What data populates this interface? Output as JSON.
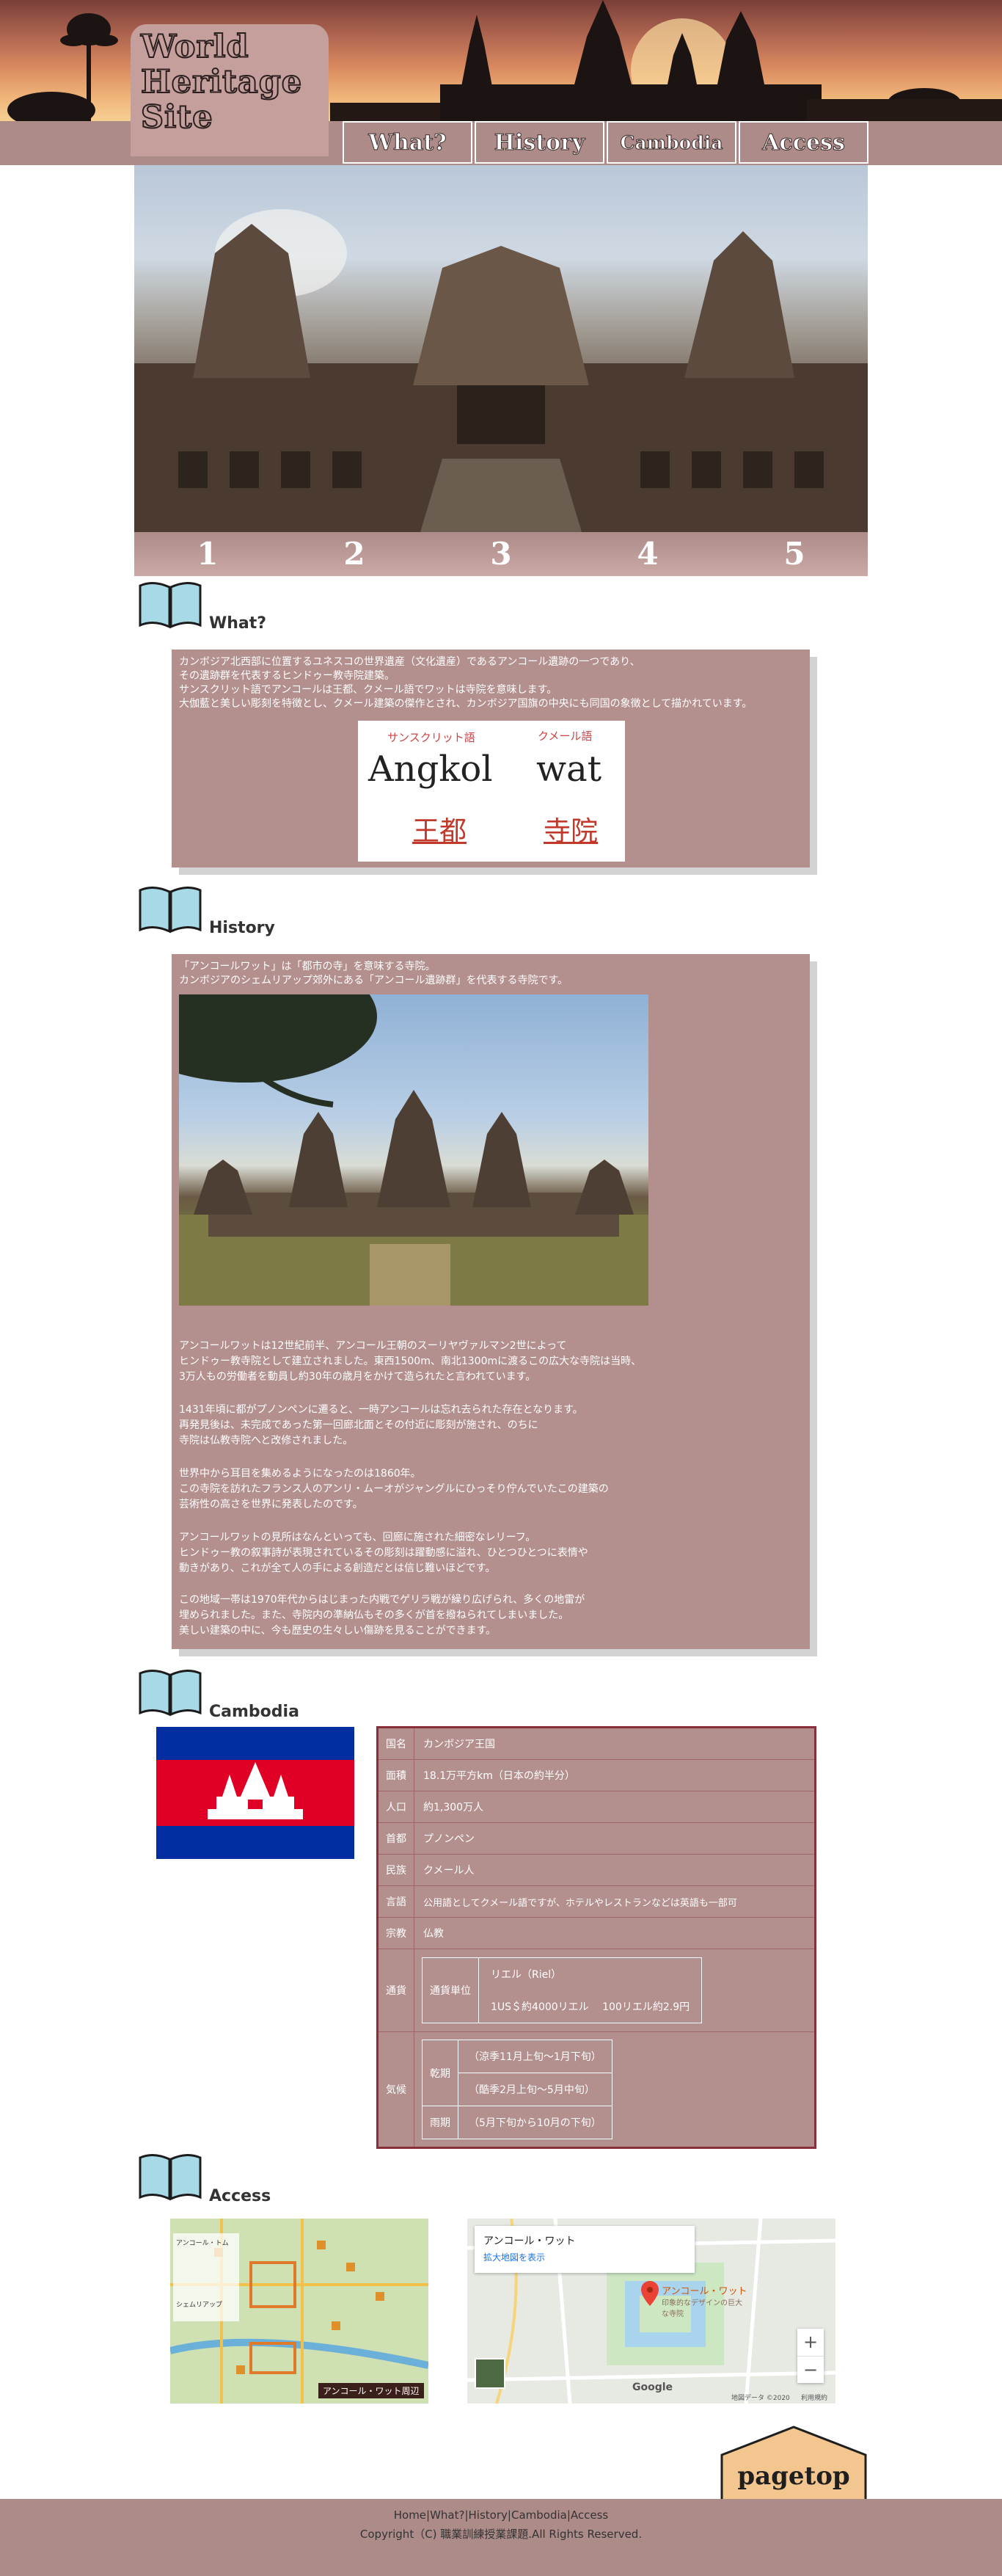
{
  "header": {
    "logo_lines": [
      "World",
      "Heritage",
      "Site"
    ],
    "nav": [
      "What?",
      "History",
      "Cambodia",
      "Access"
    ]
  },
  "slider": {
    "numbers": [
      "1",
      "2",
      "3",
      "4",
      "5"
    ]
  },
  "what": {
    "title": "What?",
    "paragraphs": [
      "カンボジア北西部に位置するユネスコの世界遺産（文化遺産）であるアンコール遺跡の一つであり、",
      "その遺跡群を代表するヒンドゥー教寺院建築。",
      "サンスクリット語でアンコールは王都、クメール語でワットは寺院を意味します。",
      "大伽藍と美しい彫刻を特徴とし、クメール建築の傑作とされ、カンボジア国旗の中央にも同国の象徴として描かれています。"
    ],
    "words": {
      "label_left": "サンスクリット語",
      "label_right": "クメール語",
      "word_left": "Angkol",
      "word_right": "wat",
      "meaning_left": "王都",
      "meaning_right": "寺院"
    }
  },
  "history": {
    "title": "History",
    "intro": [
      "「アンコールワット」は「都市の寺」を意味する寺院。",
      "カンボジアのシェムリアップ郊外にある「アンコール遺跡群」を代表する寺院です。"
    ],
    "paragraphs": [
      [
        "アンコールワットは12世紀前半、アンコール王朝のスーリヤヴァルマン2世によって",
        "ヒンドゥー教寺院として建立されました。東西1500m、南北1300mに渡るこの広大な寺院は当時、",
        "3万人もの労働者を動員し約30年の歳月をかけて造られたと言われています。"
      ],
      [
        "1431年頃に都がプノンペンに遷ると、一時アンコールは忘れ去られた存在となります。",
        "再発見後は、未完成であった第一回廊北面とその付近に彫刻が施され、のちに",
        "寺院は仏教寺院へと改修されました。"
      ],
      [
        "世界中から耳目を集めるようになったのは1860年。",
        "この寺院を訪れたフランス人のアンリ・ムーオがジャングルにひっそり佇んでいたこの建築の",
        "芸術性の高さを世界に発表したのです。"
      ],
      [
        "アンコールワットの見所はなんといっても、回廊に施された細密なレリーフ。",
        "ヒンドゥー教の叙事詩が表現されているその彫刻は躍動感に溢れ、ひとつひとつに表情や",
        "動きがあり、これが全て人の手による創造だとは信じ難いほどです。"
      ],
      [
        "この地域一帯は1970年代からはじまった内戦でゲリラ戦が繰り広げられ、多くの地雷が",
        "埋められました。また、寺院内の準納仏もその多くが首を撥ねられてしまいました。",
        "美しい建築の中に、今も歴史の生々しい傷跡を見ることができます。"
      ]
    ]
  },
  "cambodia": {
    "title": "Cambodia",
    "rows": [
      {
        "key": "国名",
        "value": "カンボジア王国"
      },
      {
        "key": "面積",
        "value": "18.1万平方km（日本の約半分）"
      },
      {
        "key": "人口",
        "value": "約1,300万人"
      },
      {
        "key": "首都",
        "value": "プノンペン"
      },
      {
        "key": "民族",
        "value": "クメール人"
      },
      {
        "key": "言語",
        "value": "公用語としてクメール語ですが、ホテルやレストランなどは英語も一部可"
      },
      {
        "key": "宗教",
        "value": "仏教"
      }
    ],
    "currency": {
      "key": "通貨",
      "sub_key": "通貨単位",
      "line1": "リエル（Riel）",
      "line2": "1US＄約4000リエル　 100リエル約2.9円"
    },
    "climate": {
      "key": "気候",
      "rows": [
        {
          "key": "乾期",
          "value": "（涼季11月上旬〜1月下旬）"
        },
        {
          "key": "",
          "value": "（酷季2月上旬〜5月中旬）"
        },
        {
          "key": "雨期",
          "value": "（5月下旬から10月の下旬）"
        }
      ]
    }
  },
  "access": {
    "title": "Access",
    "map1_title": "アンコール・ワット周辺",
    "map1_labels": [
      "アンコール・トム",
      "シェムリアップ"
    ],
    "map2": {
      "place": "アンコール・ワット",
      "enlarge": "拡大地図を表示",
      "pin_label": "アンコール・ワット",
      "pin_sub": "印象的なデザインの巨大な寺院",
      "zoom_in": "+",
      "zoom_out": "−",
      "google": "Google",
      "map_data": "地図データ ©2020",
      "terms": "利用規約"
    }
  },
  "pagetop": "pagetop",
  "footer": {
    "links": [
      "Home",
      "What?",
      "History",
      "Cambodia",
      "Access"
    ],
    "copyright": "Copyright（C) 職業訓練授業課題.All Rights Reserved."
  },
  "colors": {
    "accent": "#ad8b89",
    "panel": "#b38f8e",
    "table_border": "#8a2e3a",
    "book_icon": "#a8d9e6"
  }
}
